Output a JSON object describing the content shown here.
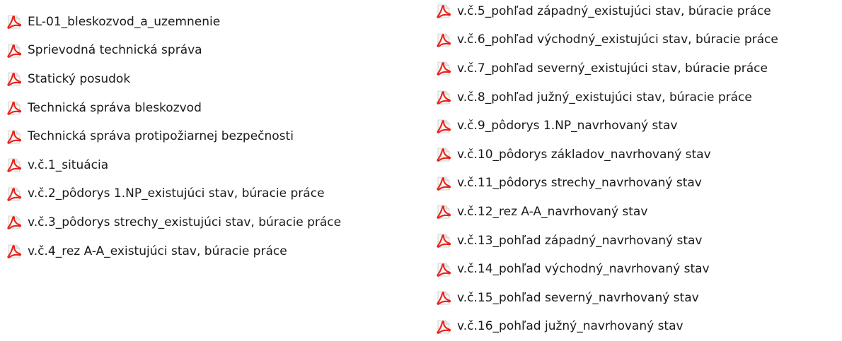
{
  "file_list": {
    "icon": "pdf-file-icon",
    "icon_color": "#e8231a",
    "left_column": [
      "EL-01_bleskozvod_a_uzemnenie",
      "Sprievodná technická správa",
      "Statický posudok",
      "Technická správa bleskozvod",
      "Technická správa protipožiarnej bezpečnosti",
      "v.č.1_situácia",
      "v.č.2_pôdorys 1.NP_existujúci stav, búracie práce",
      "v.č.3_pôdorys strechy_existujúci stav, búracie práce",
      "v.č.4_rez A-A_existujúci stav, búracie práce"
    ],
    "right_column": [
      "v.č.5_pohľad západný_existujúci stav, búracie práce",
      "v.č.6_pohľad východný_existujúci stav, búracie práce",
      "v.č.7_pohľad severný_existujúci stav, búracie práce",
      "v.č.8_pohľad južný_existujúci stav, búracie práce",
      "v.č.9_pôdorys 1.NP_navrhovaný stav",
      "v.č.10_pôdorys základov_navrhovaný stav",
      "v.č.11_pôdorys strechy_navrhovaný stav",
      "v.č.12_rez A-A_navrhovaný stav",
      "v.č.13_pohľad západný_navrhovaný stav",
      "v.č.14_pohľad východný_navrhovaný stav",
      "v.č.15_pohľad severný_navrhovaný stav",
      "v.č.16_pohľad južný_navrhovaný stav"
    ]
  }
}
